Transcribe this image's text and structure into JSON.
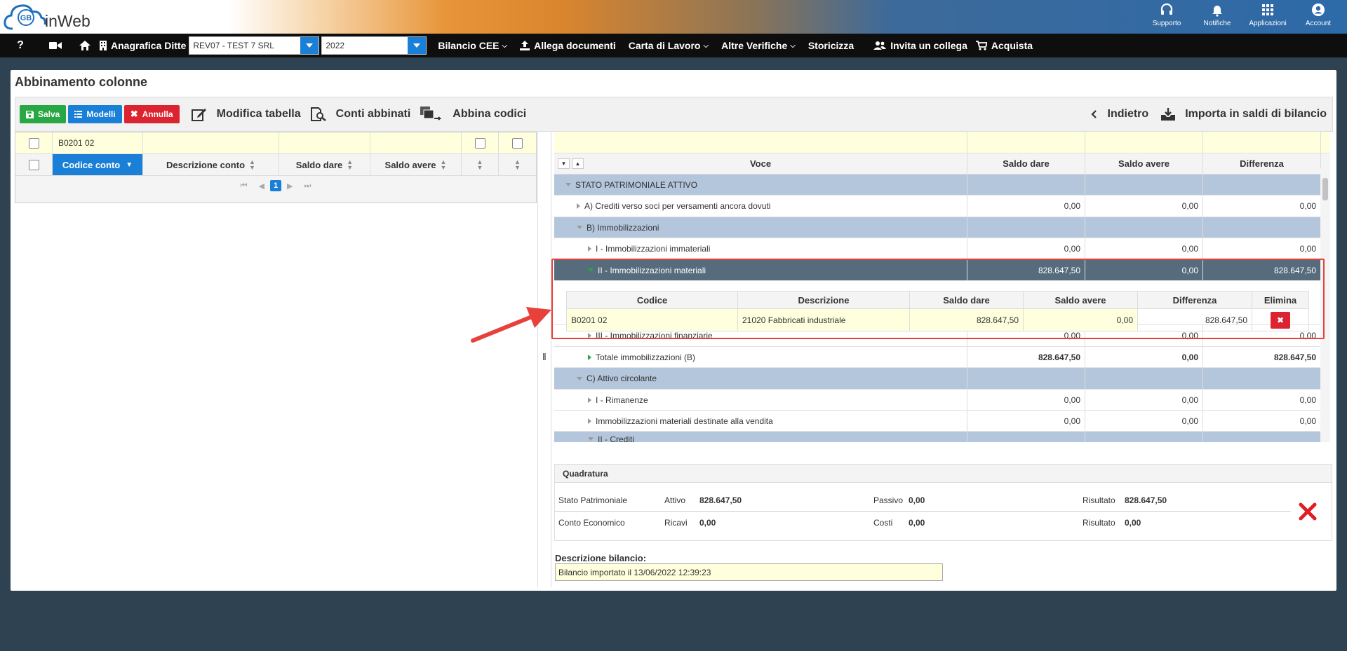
{
  "brand": {
    "name": "inWeb",
    "badge": "GB"
  },
  "top_icons": [
    {
      "icon": "headset-icon",
      "label": "Supporto"
    },
    {
      "icon": "bell-icon",
      "label": "Notifiche"
    },
    {
      "icon": "grid-icon",
      "label": "Applicazioni"
    },
    {
      "icon": "user-icon",
      "label": "Account"
    }
  ],
  "navbar": {
    "anagrafica_label": "Anagrafica Ditte",
    "company_value": "REV07 - TEST 7 SRL",
    "year_value": "2022",
    "bilancio_cee": "Bilancio CEE",
    "allega_documenti": "Allega documenti",
    "carta_lavoro": "Carta di Lavoro",
    "altre_verifiche": "Altre Verifiche",
    "storicizza": "Storicizza",
    "invita_collega": "Invita un collega",
    "acquista": "Acquista"
  },
  "page": {
    "title": "Abbinamento colonne"
  },
  "toolbar": {
    "salva": "Salva",
    "modelli": "Modelli",
    "annulla": "Annulla",
    "modifica_tabella": "Modifica tabella",
    "conti_abbinati": "Conti abbinati",
    "abbina_codici": "Abbina codici",
    "indietro": "Indietro",
    "importa_saldi": "Importa in saldi di bilancio"
  },
  "left_grid": {
    "filter_value": "B0201 02",
    "columns": [
      "Codice conto",
      "Descrizione conto",
      "Saldo dare",
      "Saldo avere"
    ],
    "page": "1"
  },
  "right_table": {
    "columns": [
      "Voce",
      "Saldo dare",
      "Saldo avere",
      "Differenza"
    ],
    "rows": [
      {
        "voce": "STATO PATRIMONIALE ATTIVO",
        "dare": "",
        "avere": "",
        "diff": ""
      },
      {
        "voce": "A) Crediti verso soci per versamenti ancora dovuti",
        "dare": "0,00",
        "avere": "0,00",
        "diff": "0,00"
      },
      {
        "voce": "B) Immobilizzazioni",
        "dare": "",
        "avere": "",
        "diff": ""
      },
      {
        "voce": "I - Immobilizzazioni immateriali",
        "dare": "0,00",
        "avere": "0,00",
        "diff": "0,00"
      },
      {
        "voce": "II - Immobilizzazioni materiali",
        "dare": "828.647,50",
        "avere": "0,00",
        "diff": "828.647,50"
      },
      {
        "voce": "III - Immobilizzazioni finanziarie",
        "dare": "0,00",
        "avere": "0,00",
        "diff": "0,00"
      },
      {
        "voce": "Totale immobilizzazioni (B)",
        "dare": "828.647,50",
        "avere": "0,00",
        "diff": "828.647,50"
      },
      {
        "voce": "C) Attivo circolante",
        "dare": "",
        "avere": "",
        "diff": ""
      },
      {
        "voce": "I - Rimanenze",
        "dare": "0,00",
        "avere": "0,00",
        "diff": "0,00"
      },
      {
        "voce": "Immobilizzazioni materiali destinate alla vendita",
        "dare": "0,00",
        "avere": "0,00",
        "diff": "0,00"
      },
      {
        "voce": "II - Crediti",
        "dare": "",
        "avere": "",
        "diff": ""
      }
    ]
  },
  "sub_table": {
    "columns": [
      "Codice",
      "Descrizione",
      "Saldo dare",
      "Saldo avere",
      "Differenza",
      "Elimina"
    ],
    "row": {
      "codice": "B0201 02",
      "descrizione": "21020  Fabbricati industriale",
      "dare": "828.647,50",
      "avere": "0,00",
      "diff": "828.647,50"
    }
  },
  "quadratura": {
    "title": "Quadratura",
    "sp_label": "Stato Patrimoniale",
    "attivo_label": "Attivo",
    "attivo_value": "828.647,50",
    "passivo_label": "Passivo",
    "passivo_value": "0,00",
    "risultato_label": "Risultato",
    "risultato_sp": "828.647,50",
    "ce_label": "Conto Economico",
    "ricavi_label": "Ricavi",
    "ricavi_value": "0,00",
    "costi_label": "Costi",
    "costi_value": "0,00",
    "risultato_ce": "0,00",
    "status_icon": "x-mark-icon"
  },
  "descrizione": {
    "label": "Descrizione bilancio:",
    "value": "Bilancio importato il 13/06/2022 12:39:23"
  },
  "colors": {
    "accent": "#1a7fd6",
    "danger": "#dc2330",
    "success": "#28a745",
    "section_row": "#b4c6dc",
    "selected_row": "#566b7c",
    "filter_row": "#ffffdd"
  }
}
